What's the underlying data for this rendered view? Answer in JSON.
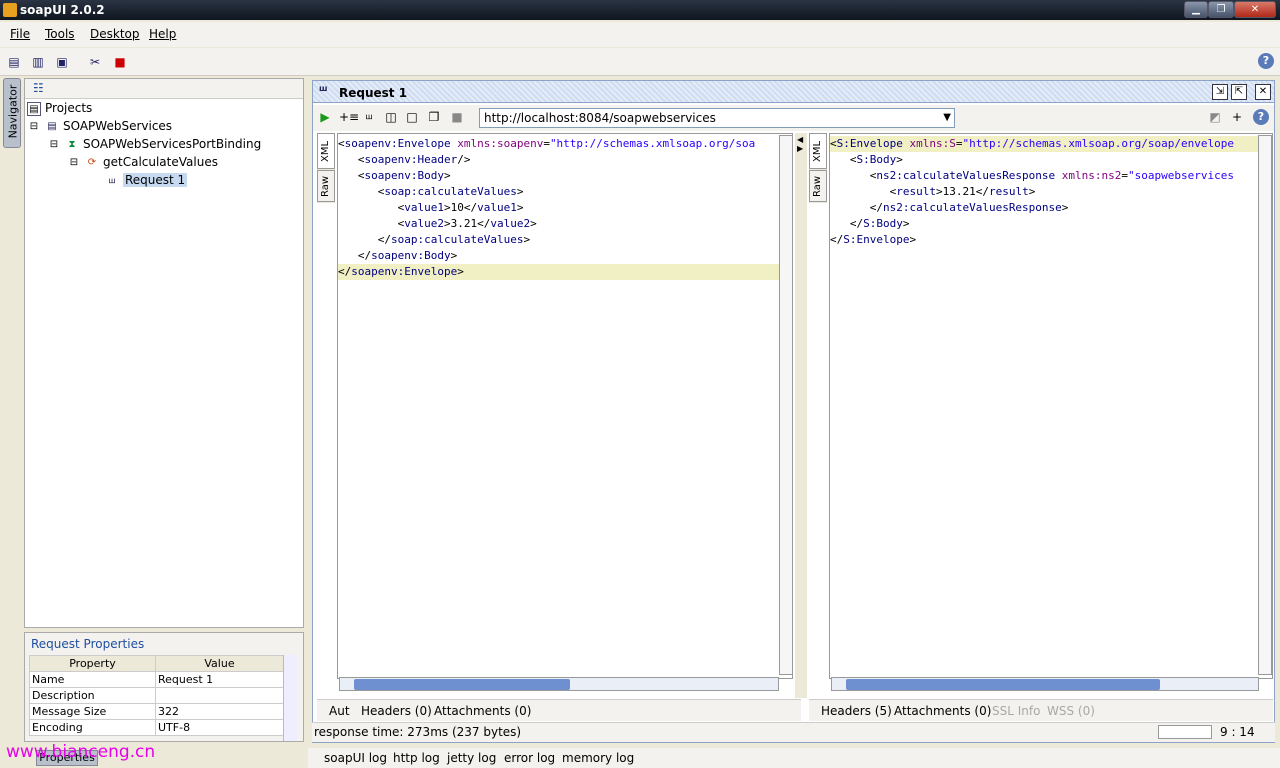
{
  "window": {
    "title": "soapUI 2.0.2"
  },
  "menu": {
    "file": "File",
    "tools": "Tools",
    "desktop": "Desktop",
    "help": "Help"
  },
  "navigator": {
    "tab_label": "Navigator",
    "projects": "Projects",
    "project": "SOAPWebServices",
    "binding": "SOAPWebServicesPortBinding",
    "operation": "getCalculateValues",
    "request": "Request 1"
  },
  "properties": {
    "title": "Request Properties",
    "col_property": "Property",
    "col_value": "Value",
    "rows": [
      {
        "k": "Name",
        "v": "Request 1"
      },
      {
        "k": "Description",
        "v": ""
      },
      {
        "k": "Message Size",
        "v": "322"
      },
      {
        "k": "Encoding",
        "v": "UTF-8"
      }
    ],
    "tab_label": "Properties"
  },
  "request": {
    "title": "Request 1",
    "url": "http://localhost:8084/soapwebservices",
    "xml_tab": "XML",
    "raw_tab": "Raw",
    "req_tabs": {
      "aut": "Aut",
      "headers": "Headers (0)",
      "attachments": "Attachments (0)"
    },
    "resp_tabs": {
      "headers": "Headers (5)",
      "attachments": "Attachments (0)",
      "ssl": "SSL Info",
      "wss": "WSS (0)"
    },
    "status": "response time: 273ms (237 bytes)",
    "cursor": "9 : 14"
  },
  "logs": {
    "soapui": "soapUI log",
    "http": "http log",
    "jetty": "jetty log",
    "error": "error log",
    "memory": "memory log"
  },
  "watermark": "www.bianceng.cn",
  "colors": {
    "titlebar": "#1a2230",
    "accent": "#c5d9f1",
    "highlight_line": "#f0f0c4",
    "watermark": "#e800e8"
  }
}
